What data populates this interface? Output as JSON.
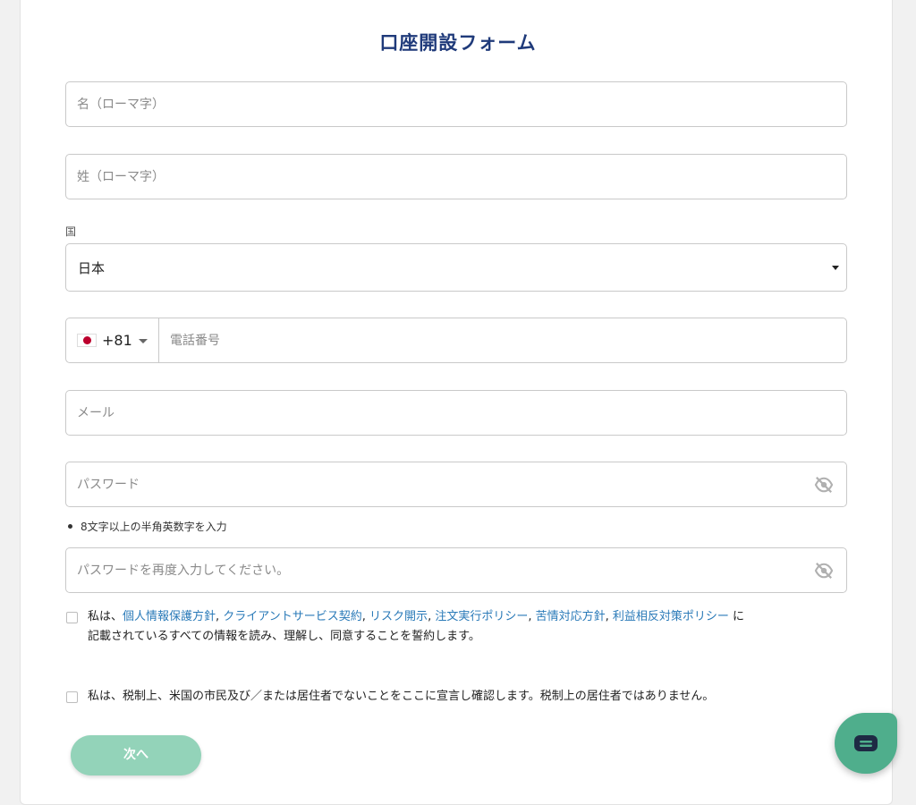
{
  "form": {
    "title": "口座開設フォーム",
    "first_name_placeholder": "名（ローマ字）",
    "last_name_placeholder": "姓（ローマ字）",
    "country_label": "国",
    "country_value": "日本",
    "phone": {
      "dial_code": "+81",
      "placeholder": "電話番号",
      "flag": "japan-flag"
    },
    "email_placeholder": "メール",
    "password_placeholder": "パスワード",
    "password_hint": "8文字以上の半角英数字を入力",
    "password_confirm_placeholder": "パスワードを再度入力してください。",
    "consent": {
      "prefix": "私は、",
      "links": [
        "個人情報保護方針",
        "クライアントサービス契約",
        "リスク開示",
        "注文実行ポリシー",
        "苦情対応方針",
        "利益相反対策ポリシー"
      ],
      "sep": ", ",
      "suffix_1": " に",
      "suffix_2": "記載されているすべての情報を読み、理解し、同意することを誓約します。"
    },
    "tax_declaration": "私は、税制上、米国の市民及び／または居住者でないことをここに宣言し確認します。税制上の居住者ではありません。",
    "next_button": "次へ"
  },
  "colors": {
    "title": "#1f3a7a",
    "link": "#2a7ab8",
    "button": "#93d3b9",
    "chat": "#4fae8c"
  },
  "icons": [
    "eye-off-icon",
    "chevron-down-icon",
    "chat-icon"
  ]
}
